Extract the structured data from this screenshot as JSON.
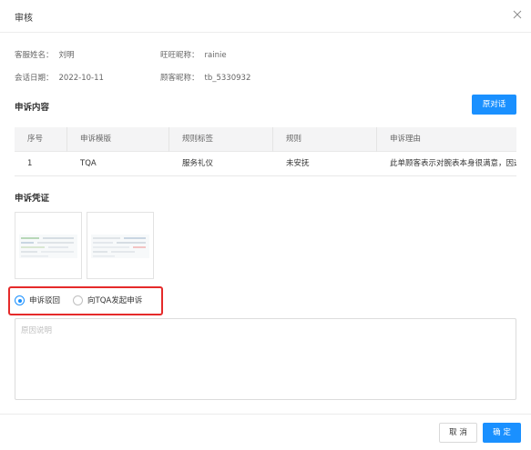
{
  "dialog": {
    "title": "审核"
  },
  "info": {
    "agent_label": "客服姓名：",
    "agent_value": "刘明",
    "wangwang_label": "旺旺昵称：",
    "wangwang_value": "rainie",
    "date_label": "会话日期：",
    "date_value": "2022-10-11",
    "customer_label": "顾客昵称：",
    "customer_value": "tb_5330932"
  },
  "appeal_content": {
    "title": "申诉内容",
    "original_dialog_button": "原对话",
    "columns": [
      "序号",
      "申诉模版",
      "规则标签",
      "规则",
      "申诉理由"
    ],
    "rows": [
      [
        "1",
        "TQA",
        "服务礼仪",
        "未安抚",
        "此单顾客表示对腕表本身很满意，因选购"
      ]
    ]
  },
  "appeal_evidence": {
    "title": "申诉凭证"
  },
  "decision": {
    "options": [
      "申诉驳回",
      "向TQA发起申诉"
    ],
    "selected": "申诉驳回"
  },
  "reason": {
    "placeholder": "原因说明",
    "value": ""
  },
  "footer": {
    "cancel_label": "取 消",
    "confirm_label": "确 定"
  },
  "colors": {
    "primary": "#1a90ff",
    "highlight": "#e52a2a"
  }
}
